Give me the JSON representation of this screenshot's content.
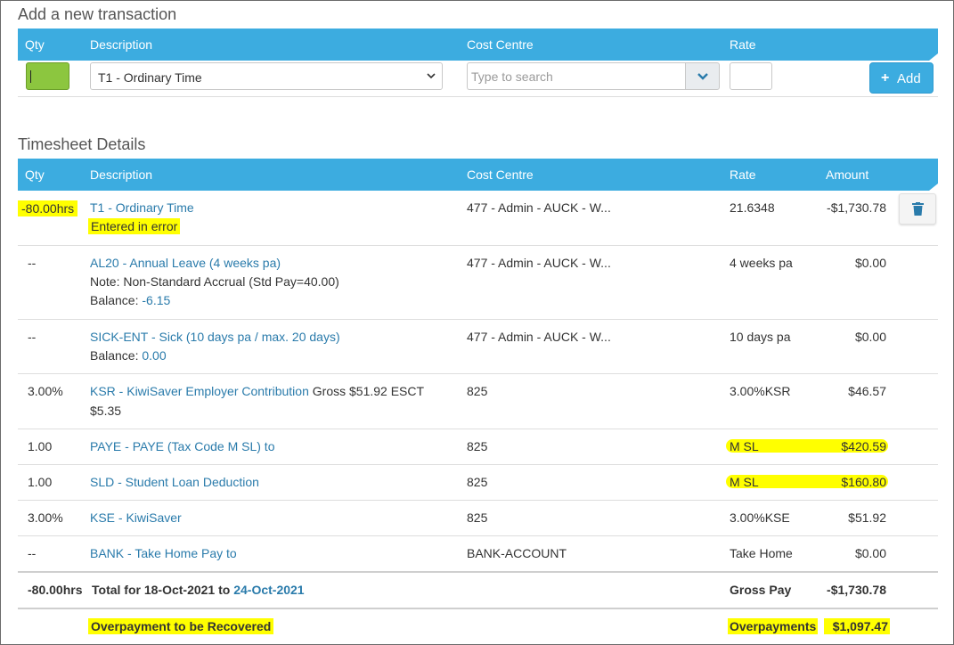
{
  "add_section": {
    "title": "Add a new transaction",
    "headers": {
      "qty": "Qty",
      "description": "Description",
      "cost_centre": "Cost Centre",
      "rate": "Rate"
    },
    "description_selected": "T1 - Ordinary Time",
    "cost_centre_placeholder": "Type to search",
    "add_label": "Add",
    "add_icon": "plus-icon"
  },
  "details": {
    "title": "Timesheet Details",
    "headers": {
      "qty": "Qty",
      "description": "Description",
      "cost_centre": "Cost Centre",
      "rate": "Rate",
      "amount": "Amount"
    },
    "rows": [
      {
        "qty": "-80.00hrs",
        "desc": "T1 - Ordinary Time",
        "note": "Entered in error",
        "cost_centre": "477 - Admin - AUCK - W...",
        "rate": "21.6348",
        "amount": "-$1,730.78"
      },
      {
        "qty": "--",
        "desc": "AL20 - Annual Leave (4 weeks pa)",
        "note": "Note: Non-Standard Accrual (Std Pay=40.00)",
        "balance_label": "Balance:",
        "balance_value": "-6.15",
        "cost_centre": "477 - Admin - AUCK - W...",
        "rate": "4 weeks pa",
        "amount": "$0.00"
      },
      {
        "qty": "--",
        "desc": "SICK-ENT - Sick (10 days pa / max. 20 days)",
        "balance_label": "Balance:",
        "balance_value": "0.00",
        "cost_centre": "477 - Admin - AUCK - W...",
        "rate": "10 days pa",
        "amount": "$0.00"
      },
      {
        "qty": "3.00%",
        "desc": "KSR - KiwiSaver Employer Contribution",
        "desc_extra": "Gross $51.92 ESCT",
        "desc_line2": "$5.35",
        "cost_centre": "825",
        "rate": "3.00%KSR",
        "amount": "$46.57"
      },
      {
        "qty": "1.00",
        "desc": "PAYE - PAYE (Tax Code M SL) to",
        "cost_centre": "825",
        "rate": "M SL",
        "amount": "$420.59"
      },
      {
        "qty": "1.00",
        "desc": "SLD - Student Loan Deduction",
        "cost_centre": "825",
        "rate": "M SL",
        "amount": "$160.80"
      },
      {
        "qty": "3.00%",
        "desc": "KSE - KiwiSaver",
        "cost_centre": "825",
        "rate": "3.00%KSE",
        "amount": "$51.92"
      },
      {
        "qty": "--",
        "desc": "BANK - Take Home Pay to",
        "cost_centre": "BANK-ACCOUNT",
        "rate": "Take Home",
        "amount": "$0.00"
      }
    ],
    "total": {
      "qty": "-80.00hrs",
      "prefix": "Total for 18-Oct-2021 to",
      "end_date": "24-Oct-2021",
      "label": "Gross Pay",
      "amount": "-$1,730.78"
    },
    "overpayment": {
      "label": "Overpayment to be Recovered",
      "total_label": "Overpayments",
      "amount": "$1,097.47"
    },
    "delete_icon": "trash-icon"
  },
  "colors": {
    "header": "#3cace0",
    "link": "#2a7bab",
    "qty_input": "#8cc63f",
    "highlight": "#ffff00"
  }
}
